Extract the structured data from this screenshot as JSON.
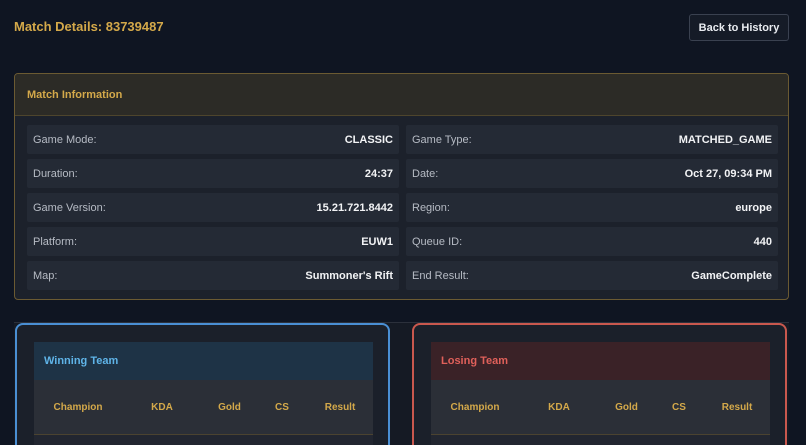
{
  "header": {
    "title": "Match Details: 83739487",
    "back_label": "Back to History"
  },
  "match_info": {
    "title": "Match Information",
    "left": [
      {
        "label": "Game Mode:",
        "value": "CLASSIC"
      },
      {
        "label": "Duration:",
        "value": "24:37"
      },
      {
        "label": "Game Version:",
        "value": "15.21.721.8442"
      },
      {
        "label": "Platform:",
        "value": "EUW1"
      },
      {
        "label": "Map:",
        "value": "Summoner's Rift"
      }
    ],
    "right": [
      {
        "label": "Game Type:",
        "value": "MATCHED_GAME"
      },
      {
        "label": "Date:",
        "value": "Oct 27, 09:34 PM"
      },
      {
        "label": "Region:",
        "value": "europe"
      },
      {
        "label": "Queue ID:",
        "value": "440"
      },
      {
        "label": "End Result:",
        "value": "GameComplete"
      }
    ]
  },
  "teams": {
    "winning": {
      "title": "Winning Team",
      "columns": [
        "Champion",
        "KDA",
        "Gold",
        "CS",
        "Result"
      ]
    },
    "losing": {
      "title": "Losing Team",
      "columns": [
        "Champion",
        "KDA",
        "Gold",
        "CS",
        "Result"
      ]
    }
  },
  "colors": {
    "accent_gold": "#d4a94a",
    "win_blue": "#4a8fd4",
    "lose_red": "#c9584e",
    "background": "#0f1522"
  }
}
